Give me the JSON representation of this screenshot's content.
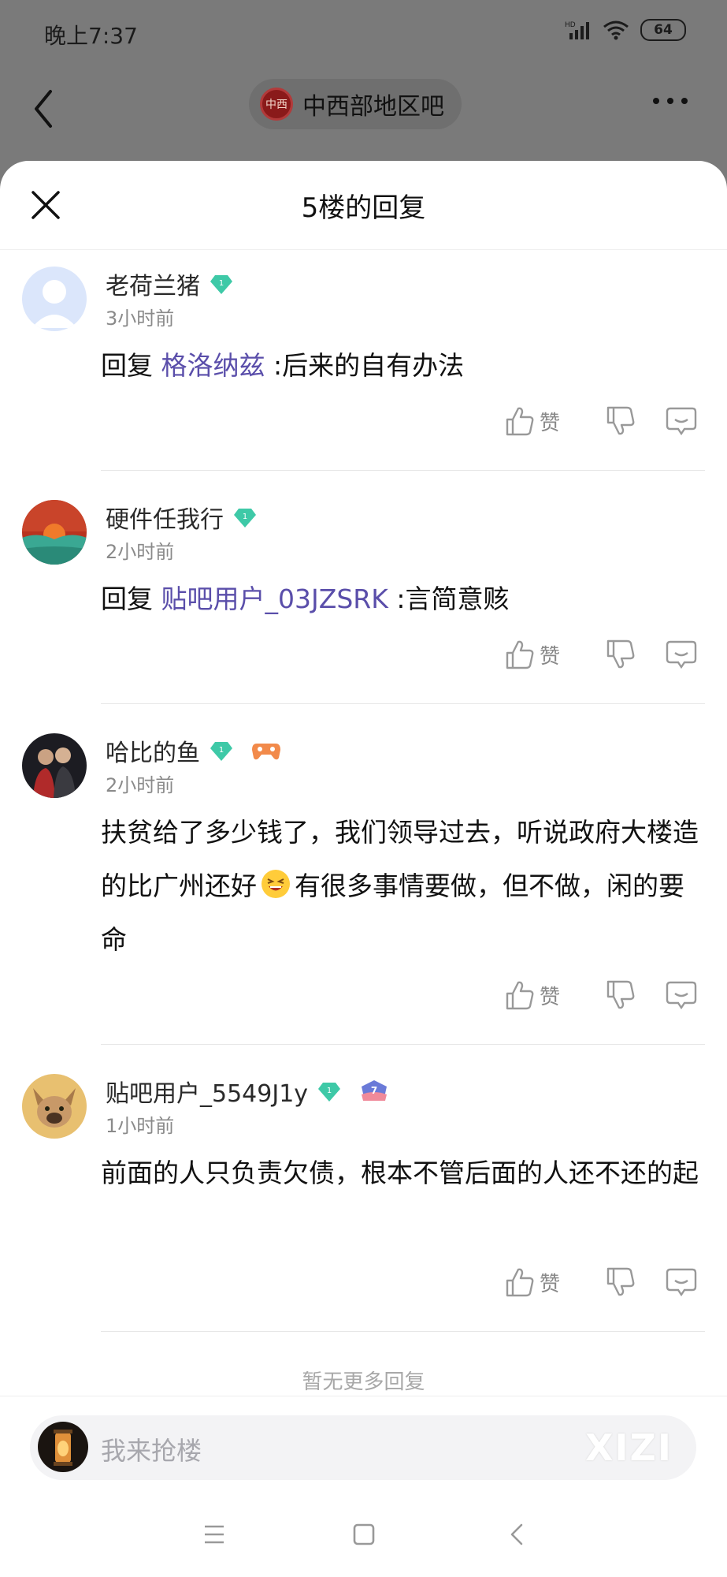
{
  "status_bar": {
    "time": "晚上7:37",
    "battery": "64"
  },
  "header": {
    "forum_name": "中西部地区吧",
    "forum_logo_text": "中西"
  },
  "sheet": {
    "title": "5楼的回复",
    "no_more": "暂无更多回复"
  },
  "replies": [
    {
      "username": "老荷兰猪",
      "time_ago": "3小时前",
      "prefix": "回复 ",
      "mention": "格洛纳兹",
      "text": " :后来的自有办法",
      "like_label": "赞"
    },
    {
      "username": "硬件任我行",
      "time_ago": "2小时前",
      "prefix": "回复 ",
      "mention": "贴吧用户_03JZSRK",
      "text": " :言简意赅",
      "like_label": "赞"
    },
    {
      "username": "哈比的鱼",
      "time_ago": "2小时前",
      "text_part1": "扶贫给了多少钱了，我们领导过去，听说政府大楼造的比广州还好",
      "text_part2": "有很多事情要做，但不做，闲的要命",
      "like_label": "赞"
    },
    {
      "username": "贴吧用户_5549J1y",
      "time_ago": "1小时前",
      "text": "前面的人只负责欠债，根本不管后面的人还不还的起",
      "like_label": "赞"
    }
  ],
  "input": {
    "placeholder": "我来抢楼",
    "watermark": "XIZI"
  },
  "colors": {
    "mention": "#5a4eaa",
    "gem": "#3ec9a7"
  }
}
